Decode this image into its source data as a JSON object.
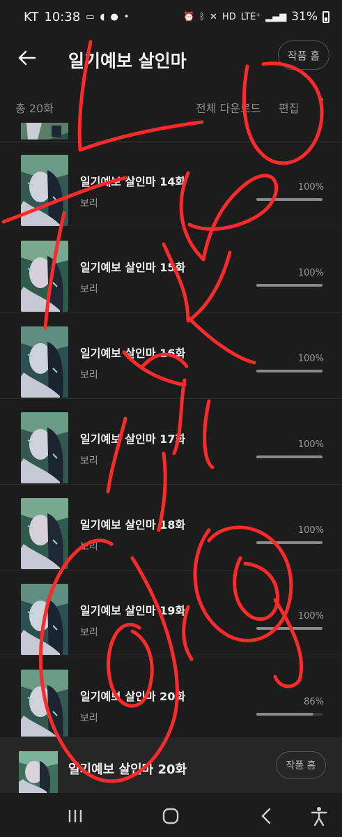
{
  "status_bar": {
    "carrier": "KT",
    "time": "10:38",
    "network": "LTE⁺",
    "battery": "31%"
  },
  "header": {
    "title": "일기예보 살인마",
    "home_button": "작품 홈"
  },
  "toolbar": {
    "total": "총 20화",
    "download_all": "전체 다운로드",
    "edit": "편집"
  },
  "episodes": [
    {
      "title": "일기예보 살인마 14화",
      "author": "보리",
      "progress_label": "100%",
      "progress": 1.0
    },
    {
      "title": "일기예보 살인마 15화",
      "author": "보리",
      "progress_label": "100%",
      "progress": 1.0
    },
    {
      "title": "일기예보 살인마 16화",
      "author": "보리",
      "progress_label": "100%",
      "progress": 1.0
    },
    {
      "title": "일기예보 살인마 17화",
      "author": "보리",
      "progress_label": "100%",
      "progress": 1.0
    },
    {
      "title": "일기예보 살인마 18화",
      "author": "보리",
      "progress_label": "100%",
      "progress": 1.0
    },
    {
      "title": "일기예보 살인마 19화",
      "author": "보리",
      "progress_label": "100%",
      "progress": 1.0
    },
    {
      "title": "일기예보 살인마 20화",
      "author": "보리",
      "progress_label": "86%",
      "progress": 0.86
    }
  ],
  "mini_player": {
    "title": "일기예보 살인마 20화",
    "home_button": "작품 홈"
  },
  "colors": {
    "background": "#1c1c1c",
    "scribble": "#ff2a2a",
    "progress": "#8a8a8a"
  }
}
